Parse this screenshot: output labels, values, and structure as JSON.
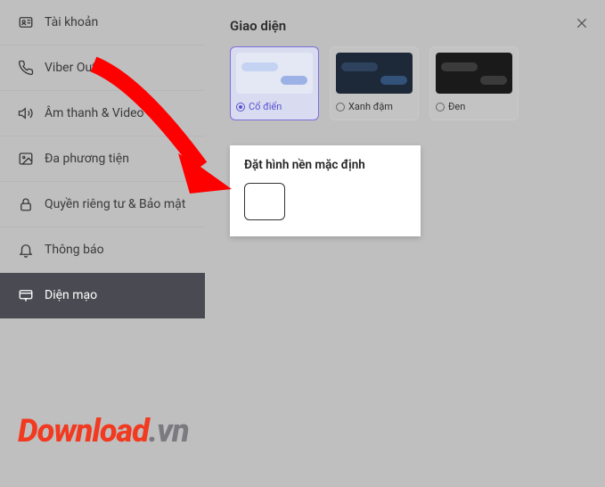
{
  "sidebar": {
    "items": [
      {
        "label": "Tài khoản"
      },
      {
        "label": "Viber Out"
      },
      {
        "label": "Âm thanh & Video"
      },
      {
        "label": "Đa phương tiện"
      },
      {
        "label": "Quyền riêng tư & Bảo mật"
      },
      {
        "label": "Thông báo"
      },
      {
        "label": "Diện mạo"
      }
    ]
  },
  "main": {
    "title": "Giao diện",
    "themes": [
      {
        "label": "Cổ điển",
        "selected": true,
        "style": "classic"
      },
      {
        "label": "Xanh đậm",
        "selected": false,
        "style": "darkblue"
      },
      {
        "label": "Đen",
        "selected": false,
        "style": "black"
      }
    ],
    "bg_section_title": "Đặt hình nền mặc định"
  },
  "watermark": {
    "brand": "Download",
    "suffix": ".vn"
  }
}
